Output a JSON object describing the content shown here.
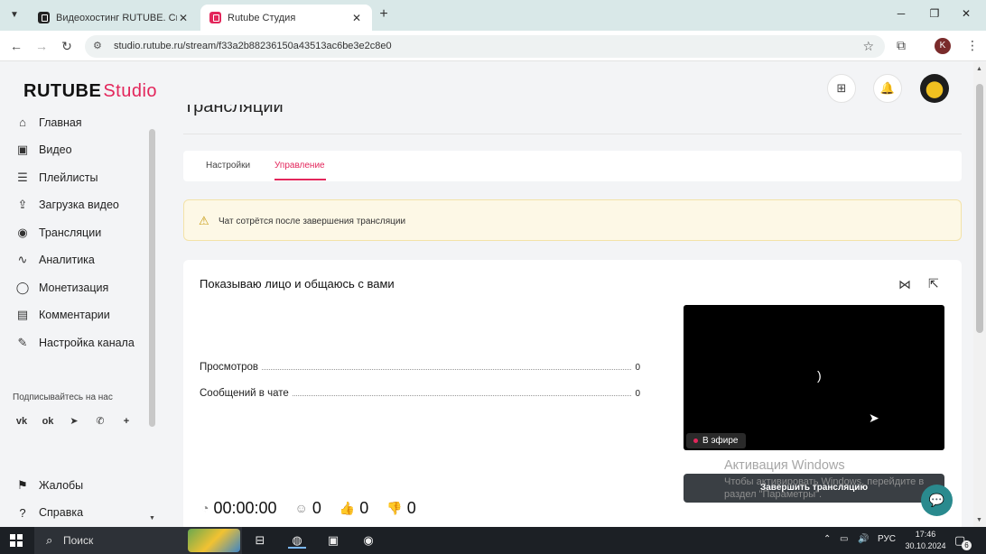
{
  "browser": {
    "tabs": [
      {
        "title": "Видеохостинг RUTUBE. Смотри",
        "active": false
      },
      {
        "title": "Rutube Студия",
        "active": true
      }
    ],
    "new_tab": "+",
    "url": "studio.rutube.ru/stream/f33a2b88236150a43513ac6be3e2c8e0",
    "profile_letter": "K"
  },
  "app": {
    "logo_main": "RUTUBE",
    "logo_sub": "Studio",
    "accent_color": "#e3265b"
  },
  "sidebar": {
    "items": [
      {
        "label": "Главная",
        "icon": "home-icon"
      },
      {
        "label": "Видео",
        "icon": "video-icon"
      },
      {
        "label": "Плейлисты",
        "icon": "playlist-icon"
      },
      {
        "label": "Загрузка видео",
        "icon": "upload-icon"
      },
      {
        "label": "Трансляции",
        "icon": "broadcast-icon"
      },
      {
        "label": "Аналитика",
        "icon": "analytics-icon"
      },
      {
        "label": "Монетизация",
        "icon": "monetization-icon"
      },
      {
        "label": "Комментарии",
        "icon": "comments-icon"
      },
      {
        "label": "Настройка канала",
        "icon": "channel-settings-icon"
      }
    ],
    "follow_label": "Подписывайтесь на нас",
    "socials": [
      {
        "label": "vk",
        "icon": "vk-icon"
      },
      {
        "label": "ok",
        "icon": "ok-icon"
      },
      {
        "label": "telegram",
        "icon": "telegram-icon"
      },
      {
        "label": "viber",
        "icon": "viber-icon"
      },
      {
        "label": "more",
        "icon": "plus-icon"
      }
    ],
    "lower": [
      {
        "label": "Жалобы",
        "icon": "flag-icon"
      },
      {
        "label": "Справка",
        "icon": "help-icon"
      }
    ]
  },
  "page": {
    "title": "Трансляции",
    "tabs": [
      {
        "label": "Настройки",
        "active": false
      },
      {
        "label": "Управление",
        "active": true
      }
    ],
    "warning": "Чат сотрётся после завершения трансляции",
    "stream": {
      "title": "Показываю лицо и общаюсь с вами",
      "stats": [
        {
          "label": "Просмотров",
          "value": "0"
        },
        {
          "label": "Сообщений в чате",
          "value": "0"
        }
      ],
      "live_badge": "В эфире",
      "end_button": "Завершить трансляцию",
      "timer": "00:00:00",
      "viewers": "0",
      "likes": "0",
      "dislikes": "0"
    }
  },
  "windows_watermark": {
    "title": "Активация Windows",
    "text": "Чтобы активировать Windows, перейдите в раздел \"Параметры\"."
  },
  "taskbar": {
    "search_placeholder": "Поиск",
    "language": "РУС",
    "time": "17:46",
    "date": "30.10.2024",
    "notifications": "6"
  }
}
